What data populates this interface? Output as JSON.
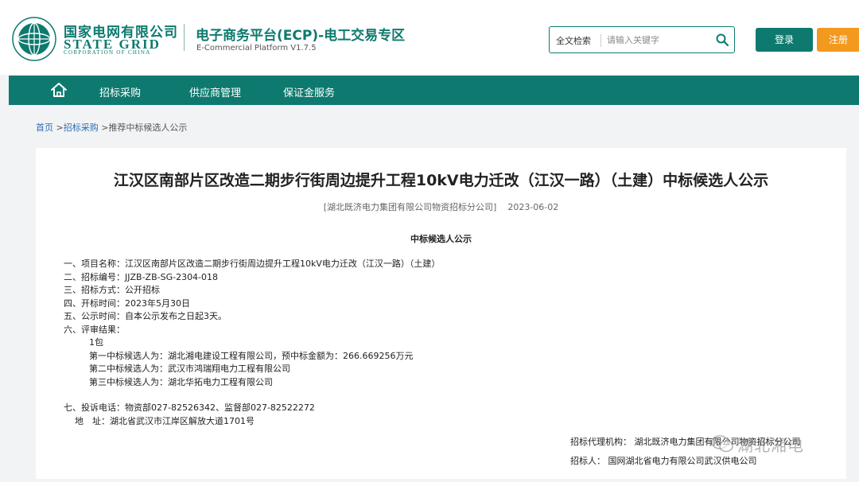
{
  "header": {
    "logo_cn": "国家电网有限公司",
    "logo_en": "STATE GRID",
    "logo_sub": "CORPORATION OF CHINA",
    "platform_title": "电子商务平台(ECP)-电工交易专区",
    "platform_version": "E-Commercial Platform V1.7.5",
    "search": {
      "scope": "全文检索",
      "placeholder": "请输入关键字"
    },
    "login_label": "登录",
    "register_label": "注册"
  },
  "nav": {
    "items": [
      {
        "label": "招标采购"
      },
      {
        "label": "供应商管理"
      },
      {
        "label": "保证金服务"
      }
    ]
  },
  "breadcrumb": {
    "home": "首页",
    "sep1": " >",
    "section": "招标采购",
    "sep2": " >",
    "current": "推荐中标候选人公示"
  },
  "article": {
    "title": "江汉区南部片区改造二期步行街周边提升工程10kV电力迁改（江汉一路）（土建）中标候选人公示",
    "source": "[湖北既济电力集团有限公司物资招标分公司]",
    "date": "2023-06-02",
    "sub_heading": "中标候选人公示",
    "lines": [
      "一、项目名称：江汉区南部片区改造二期步行街周边提升工程10kV电力迁改（江汉一路）（土建）",
      "二、招标编号：JJZB-ZB-SG-2304-018",
      "三、招标方式：公开招标",
      "四、开标时间：2023年5月30日",
      "五、公示时间：自本公示发布之日起3天。",
      "六、评审结果："
    ],
    "package": "1包",
    "candidates": [
      "第一中标候选人为：湖北湘电建设工程有限公司，预中标金额为：266.669256万元",
      "第二中标候选人为：武汉市鸿瑞翔电力工程有限公司",
      "第三中标候选人为：湖北华拓电力工程有限公司"
    ],
    "complaint": "七、投诉电话：物资部027-82526342、监督部027-82522272",
    "address": "地　址：湖北省武汉市江岸区解放大道1701号",
    "agency": "招标代理机构：  湖北既济电力集团有限公司物资招标分公司",
    "tenderer": "招标人：  国网湖北省电力有限公司武汉供电公司"
  },
  "watermark": {
    "text": "湖北湘电"
  },
  "colors": {
    "brand": "#0e7a6f",
    "register": "#f39a1e",
    "link": "#2a6db5"
  }
}
